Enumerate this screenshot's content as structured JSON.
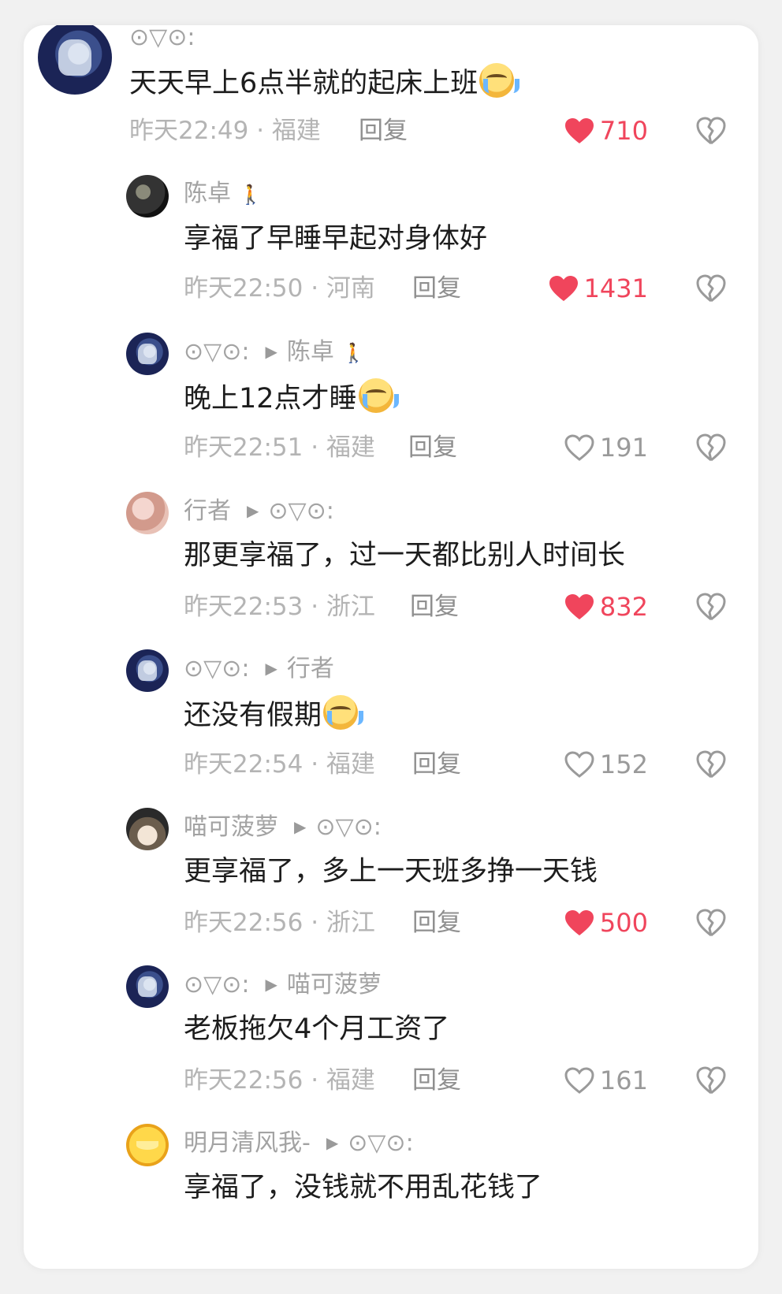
{
  "comments": [
    {
      "user": "⊙▽⊙:",
      "reply_to": "",
      "text": "天天早上6点半就的起床上班",
      "emoji": true,
      "time": "昨天22:49",
      "location": "福建",
      "reply_label": "回复",
      "likes": "710",
      "liked": true
    },
    {
      "user": "陈卓",
      "reply_to": "",
      "text": "享福了早睡早起对身体好",
      "emoji": false,
      "time": "昨天22:50",
      "location": "河南",
      "reply_label": "回复",
      "likes": "1431",
      "liked": true
    },
    {
      "user": "⊙▽⊙:",
      "reply_to": "陈卓",
      "text": "晚上12点才睡",
      "emoji": true,
      "time": "昨天22:51",
      "location": "福建",
      "reply_label": "回复",
      "likes": "191",
      "liked": false
    },
    {
      "user": "行者",
      "reply_to": "⊙▽⊙:",
      "text": "那更享福了，过一天都比别人时间长",
      "emoji": false,
      "time": "昨天22:53",
      "location": "浙江",
      "reply_label": "回复",
      "likes": "832",
      "liked": true
    },
    {
      "user": "⊙▽⊙:",
      "reply_to": "行者",
      "text": "还没有假期",
      "emoji": true,
      "time": "昨天22:54",
      "location": "福建",
      "reply_label": "回复",
      "likes": "152",
      "liked": false
    },
    {
      "user": "喵可菠萝",
      "reply_to": "⊙▽⊙:",
      "text": "更享福了，多上一天班多挣一天钱",
      "emoji": false,
      "time": "昨天22:56",
      "location": "浙江",
      "reply_label": "回复",
      "likes": "500",
      "liked": true
    },
    {
      "user": "⊙▽⊙:",
      "reply_to": "喵可菠萝",
      "text": "老板拖欠4个月工资了",
      "emoji": false,
      "time": "昨天22:56",
      "location": "福建",
      "reply_label": "回复",
      "likes": "161",
      "liked": false
    },
    {
      "user": "明月清风我-",
      "reply_to": "⊙▽⊙:",
      "text": "享福了，没钱就不用乱花钱了",
      "emoji": false,
      "time": "",
      "location": "",
      "reply_label": "",
      "likes": "",
      "liked": false
    }
  ],
  "colors": {
    "like_red": "#f0455c",
    "meta_gray": "#b4b4b4",
    "text": "#1d1d1d"
  },
  "icons": {
    "like": "heart-icon",
    "dislike": "broken-heart-icon",
    "reply_arrow": "triangle-right-icon"
  }
}
